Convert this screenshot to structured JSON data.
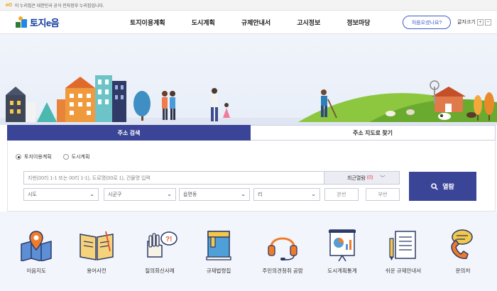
{
  "gov_banner": {
    "brand": "eG",
    "text": "이 누리집은 대한민국 공식 전자정부 누리집입니다."
  },
  "header": {
    "logo_text": "토지e음",
    "nav": [
      "토지이용계획",
      "도시계획",
      "규제안내서",
      "고시정보",
      "정보마당"
    ],
    "first_visit_button": "처음오셨나요?",
    "font_size_label": "글자크기",
    "font_plus": "+",
    "font_minus": "−"
  },
  "search": {
    "tabs": [
      "주소 검색",
      "주소 지도로 찾기"
    ],
    "active_tab": 0,
    "radios": [
      {
        "label": "토지이용계획",
        "checked": true
      },
      {
        "label": "도시계획",
        "checked": false
      }
    ],
    "address_placeholder": "지번(00리 1-1 또는 00리 1-1), 도로명(00로 1), 건물명 입력",
    "recent_label": "최근열람",
    "recent_count": "(0)",
    "selects": [
      "시도",
      "시군구",
      "읍면동",
      "리"
    ],
    "bunji_main": "본번",
    "bunji_sub": "부번",
    "search_button": "열람"
  },
  "quick_menu": [
    {
      "icon": "map-pin-icon",
      "label": "이음지도"
    },
    {
      "icon": "book-icon",
      "label": "용어사전"
    },
    {
      "icon": "question-hand-icon",
      "label": "질의회신사례"
    },
    {
      "icon": "rulebook-icon",
      "label": "규제법령집"
    },
    {
      "icon": "headset-icon",
      "label": "주민의견청취 공람"
    },
    {
      "icon": "statistics-board-icon",
      "label": "도시계획통계"
    },
    {
      "icon": "document-pen-icon",
      "label": "쉬운 규제안내서"
    },
    {
      "icon": "phone-chat-icon",
      "label": "문의처"
    }
  ],
  "colors": {
    "primary": "#3b4597",
    "accent": "#e6a118",
    "logo": "#0f3a9e"
  }
}
